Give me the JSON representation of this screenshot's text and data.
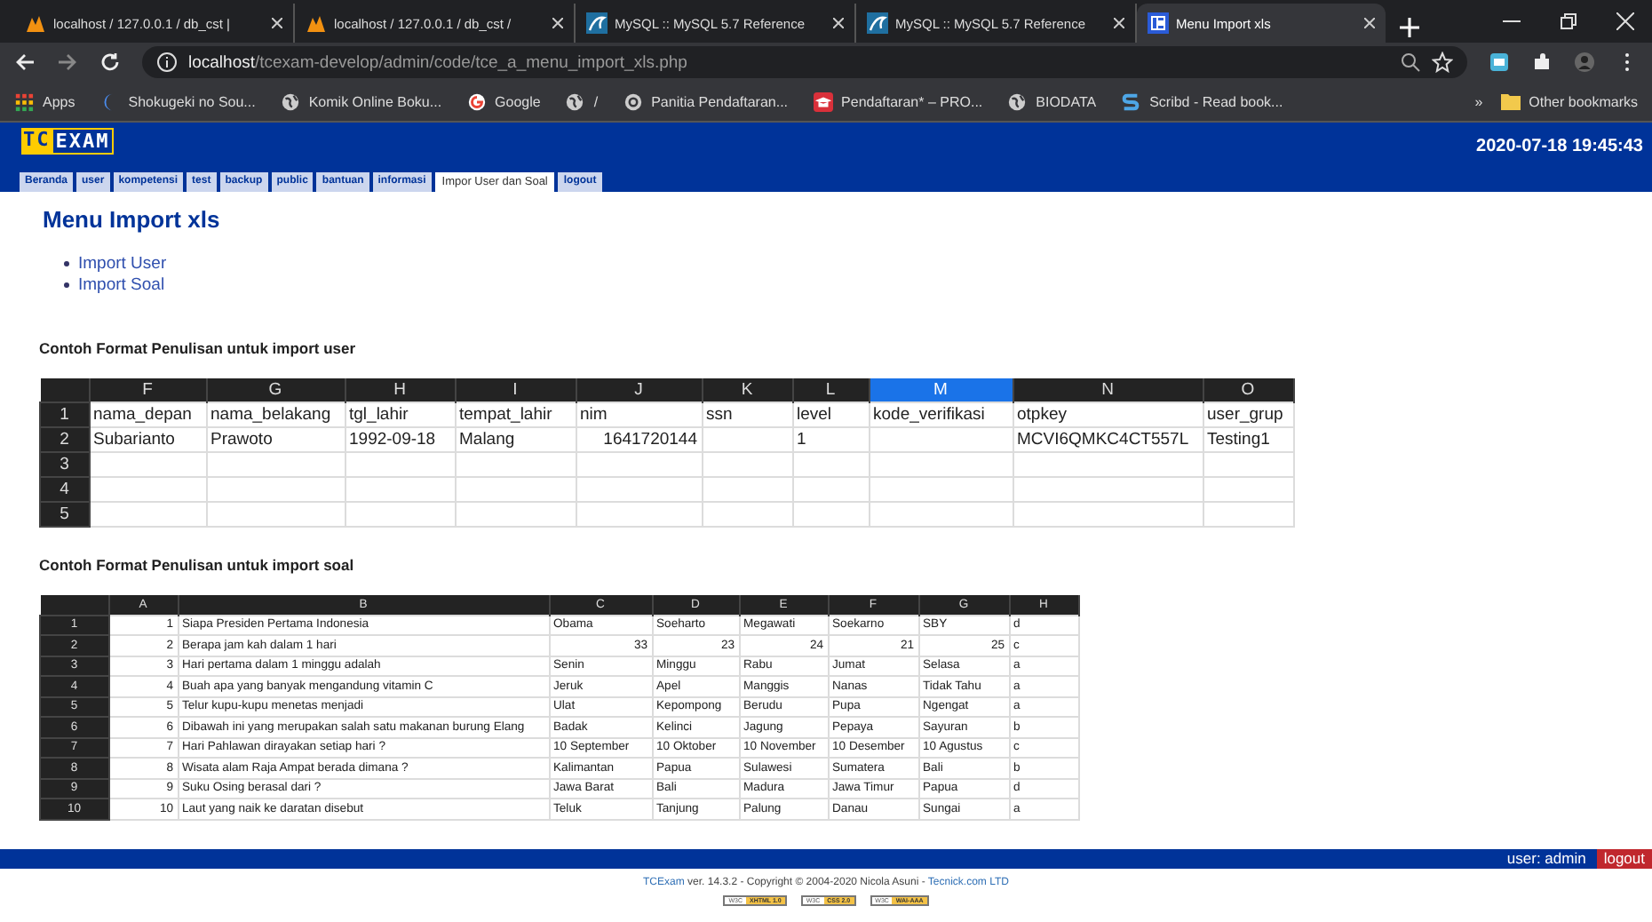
{
  "browser": {
    "tabs": [
      {
        "title": "localhost / 127.0.0.1 / db_cst |",
        "kind": "pma",
        "selected": false
      },
      {
        "title": "localhost / 127.0.0.1 / db_cst /",
        "kind": "pma",
        "selected": false
      },
      {
        "title": "MySQL :: MySQL 5.7 Reference",
        "kind": "mysql",
        "selected": false
      },
      {
        "title": "MySQL :: MySQL 5.7 Reference",
        "kind": "mysql",
        "selected": false
      },
      {
        "title": "Menu Import xls",
        "kind": "tcexam",
        "selected": true
      }
    ],
    "address": {
      "host": "localhost",
      "path": "/tcexam-develop/admin/code/tce_a_menu_import_xls.php"
    },
    "bookmarks": [
      {
        "label": "Apps",
        "kind": "apps"
      },
      {
        "label": "Shokugeki no Sou...",
        "kind": "moon"
      },
      {
        "label": "Komik Online Boku...",
        "kind": "globe"
      },
      {
        "label": "Google",
        "kind": "google"
      },
      {
        "label": "/",
        "kind": "globe"
      },
      {
        "label": "Panitia Pendaftaran...",
        "kind": "seal"
      },
      {
        "label": "Pendaftaran* – PRO...",
        "kind": "cap"
      },
      {
        "label": "BIODATA",
        "kind": "globe"
      },
      {
        "label": "Scribd - Read book...",
        "kind": "scribd"
      }
    ],
    "overflow": "»",
    "other_bookmarks": "Other bookmarks"
  },
  "app": {
    "logo": [
      "TC",
      "EXAM"
    ],
    "datetime": "2020-07-18 19:45:43",
    "menu": [
      {
        "label": "Beranda",
        "selected": false
      },
      {
        "label": "user",
        "selected": false
      },
      {
        "label": "kompetensi",
        "selected": false
      },
      {
        "label": "test",
        "selected": false
      },
      {
        "label": "backup",
        "selected": false
      },
      {
        "label": "public",
        "selected": false
      },
      {
        "label": "bantuan",
        "selected": false
      },
      {
        "label": "informasi",
        "selected": false
      },
      {
        "label": "Impor User dan Soal",
        "selected": true
      },
      {
        "label": "logout",
        "selected": false
      }
    ],
    "title": "Menu Import xls",
    "links": [
      "Import User",
      "Import Soal"
    ],
    "sections": [
      {
        "heading": "Contoh Format Penulisan untuk import user",
        "sheet": {
          "columns": [
            {
              "label": "F",
              "selected": false
            },
            {
              "label": "G",
              "selected": false
            },
            {
              "label": "H",
              "selected": false
            },
            {
              "label": "I",
              "selected": false
            },
            {
              "label": "J",
              "selected": false
            },
            {
              "label": "K",
              "selected": false
            },
            {
              "label": "L",
              "selected": false
            },
            {
              "label": "M",
              "selected": true
            },
            {
              "label": "N",
              "selected": false
            },
            {
              "label": "O",
              "selected": false
            }
          ],
          "rows": [
            {
              "number": "1",
              "cells": [
                "nama_depan",
                "nama_belakang",
                "tgl_lahir",
                "tempat_lahir",
                "nim",
                "ssn",
                "level",
                "kode_verifikasi",
                "otpkey",
                "user_grup"
              ]
            },
            {
              "number": "2",
              "cells": [
                "Subarianto",
                "Prawoto",
                "1992-09-18",
                "Malang",
                {
                  "value": "1641720144",
                  "kind": "number"
                },
                "",
                "1",
                "",
                "MCVI6QMKC4CT557L",
                "Testing1"
              ]
            },
            {
              "number": "3",
              "cells": [
                "",
                "",
                "",
                "",
                "",
                "",
                "",
                "",
                "",
                ""
              ]
            },
            {
              "number": "4",
              "cells": [
                "",
                "",
                "",
                "",
                "",
                "",
                "",
                "",
                "",
                ""
              ]
            },
            {
              "number": "5",
              "cells": [
                "",
                "",
                "",
                "",
                "",
                "",
                "",
                "",
                "",
                ""
              ]
            }
          ]
        }
      },
      {
        "heading": "Contoh Format Penulisan untuk import soal",
        "sheet": {
          "columns": [
            {
              "label": "A",
              "selected": false
            },
            {
              "label": "B",
              "selected": false
            },
            {
              "label": "C",
              "selected": false
            },
            {
              "label": "D",
              "selected": false
            },
            {
              "label": "E",
              "selected": false
            },
            {
              "label": "F",
              "selected": false
            },
            {
              "label": "G",
              "selected": false
            },
            {
              "label": "H",
              "selected": false
            }
          ],
          "rows": [
            {
              "number": "1",
              "cells": [
                {
                  "value": "1",
                  "kind": "number"
                },
                "Siapa Presiden Pertama Indonesia",
                "Obama",
                "Soeharto",
                "Megawati",
                "Soekarno",
                "SBY",
                "d"
              ]
            },
            {
              "number": "2",
              "cells": [
                {
                  "value": "2",
                  "kind": "number"
                },
                "Berapa jam kah dalam 1 hari",
                {
                  "value": "33",
                  "kind": "number"
                },
                {
                  "value": "23",
                  "kind": "number"
                },
                {
                  "value": "24",
                  "kind": "number"
                },
                {
                  "value": "21",
                  "kind": "number"
                },
                {
                  "value": "25",
                  "kind": "number"
                },
                "c"
              ]
            },
            {
              "number": "3",
              "cells": [
                {
                  "value": "3",
                  "kind": "number"
                },
                "Hari pertama dalam 1 minggu adalah",
                "Senin",
                "Minggu",
                "Rabu",
                "Jumat",
                "Selasa",
                "a"
              ]
            },
            {
              "number": "4",
              "cells": [
                {
                  "value": "4",
                  "kind": "number"
                },
                "Buah apa yang banyak mengandung vitamin C",
                "Jeruk",
                "Apel",
                "Manggis",
                "Nanas",
                "Tidak Tahu",
                "a"
              ]
            },
            {
              "number": "5",
              "cells": [
                {
                  "value": "5",
                  "kind": "number"
                },
                "Telur kupu-kupu menetas menjadi",
                "Ulat",
                "Kepompong",
                "Berudu",
                "Pupa",
                "Ngengat",
                "a"
              ]
            },
            {
              "number": "6",
              "cells": [
                {
                  "value": "6",
                  "kind": "number"
                },
                "Dibawah ini yang merupakan salah satu makanan burung Elang",
                "Badak",
                "Kelinci",
                "Jagung",
                "Pepaya",
                "Sayuran",
                "b"
              ]
            },
            {
              "number": "7",
              "cells": [
                {
                  "value": "7",
                  "kind": "number"
                },
                "Hari Pahlawan dirayakan setiap hari ?",
                "10 September",
                "10 Oktober",
                "10 November",
                "10 Desember",
                "10 Agustus",
                "c"
              ]
            },
            {
              "number": "8",
              "cells": [
                {
                  "value": "8",
                  "kind": "number"
                },
                "Wisata alam Raja Ampat berada dimana ?",
                "Kalimantan",
                "Papua",
                "Sulawesi",
                "Sumatera",
                "Bali",
                "b"
              ]
            },
            {
              "number": "9",
              "cells": [
                {
                  "value": "9",
                  "kind": "number"
                },
                "Suku Osing berasal dari ?",
                "Jawa Barat",
                "Bali",
                "Madura",
                "Jawa Timur",
                "Papua",
                "d"
              ]
            },
            {
              "number": "10",
              "cells": [
                {
                  "value": "10",
                  "kind": "number"
                },
                "Laut yang naik ke daratan disebut",
                "Teluk",
                "Tanjung",
                "Palung",
                "Danau",
                "Sungai",
                "a"
              ]
            }
          ]
        }
      }
    ],
    "footer": {
      "user": "user: admin",
      "logout": "logout",
      "copyright": {
        "product": "TCExam",
        "text": "ver. 14.3.2 - Copyright © 2004-2020 Nicola Asuni -",
        "company": "Tecnick.com LTD"
      },
      "badges": [
        {
          "org": "W3C",
          "label": "XHTML 1.0"
        },
        {
          "org": "W3C",
          "label": "CSS 2.0"
        },
        {
          "org": "W3C",
          "label": "WAI-AAA"
        }
      ]
    }
  }
}
